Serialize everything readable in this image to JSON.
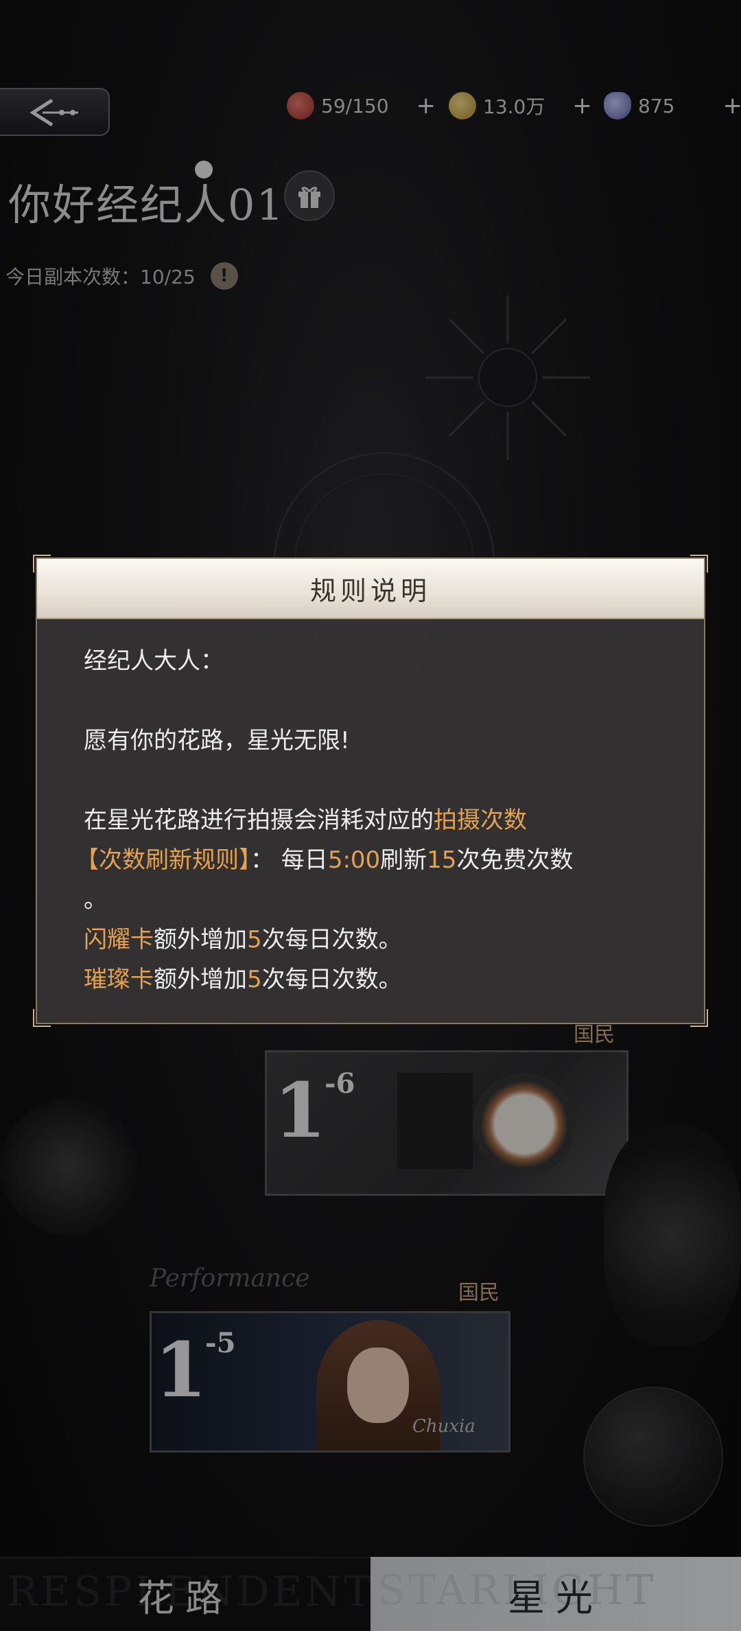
{
  "header": {
    "resources": [
      {
        "icon": "drink-icon",
        "value": "59/150",
        "color": "#c0473f"
      },
      {
        "icon": "coin-icon",
        "value": "13.0万",
        "color": "#d9b45a"
      },
      {
        "icon": "diamond-icon",
        "value": "875",
        "color": "#8e8fd0"
      }
    ],
    "plus_symbol": "+"
  },
  "profile": {
    "title": "你好经纪人01",
    "daily_count_label": "今日副本次数：10/25",
    "warn_symbol": "!"
  },
  "stages": [
    {
      "number": "1",
      "sub": "-6",
      "badge": "国民"
    },
    {
      "number": "1",
      "sub": "-5",
      "badge": "国民"
    }
  ],
  "decor_text": {
    "card_script": "Performance",
    "signature": "Chuxia"
  },
  "tabs": [
    {
      "label": "花路",
      "bg_text": "RESPLENDENT",
      "active": false
    },
    {
      "label": "星光",
      "bg_text": "STARLIGHT",
      "active": true
    }
  ],
  "modal": {
    "title": "规则说明",
    "greeting": "经纪人大人：",
    "wish": "愿有你的花路，星光无限!",
    "line1_pre": "在星光花路进行拍摄会消耗对应的",
    "line1_hl": "拍摄次数",
    "rule_label": "【次数刷新规则】",
    "rule_sep": "：  每日",
    "rule_time": "5:00",
    "rule_mid": "刷新",
    "rule_count": "15",
    "rule_post": "次免费次数",
    "rule_end": "。",
    "card1_name": "闪耀卡",
    "card1_pre": "额外增加",
    "card1_num": "5",
    "card1_post": "次每日次数。",
    "card2_name": "璀璨卡",
    "card2_pre": "额外增加",
    "card2_num": "5",
    "card2_post": "次每日次数。"
  },
  "colors": {
    "highlight": "#e6a24e",
    "modal_bg": "#343232",
    "gold_border": "#8a7a62"
  }
}
